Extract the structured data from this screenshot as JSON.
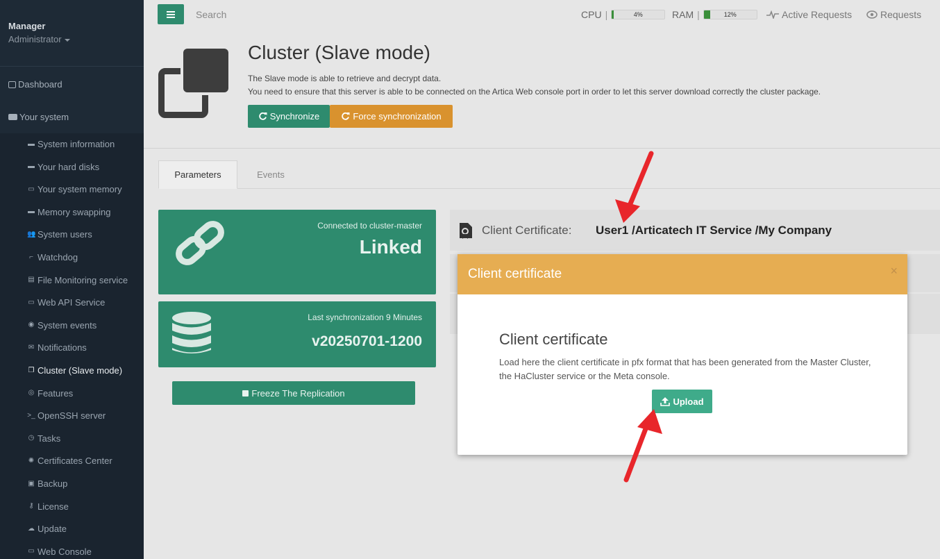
{
  "sidebar": {
    "profile_name": "Manager",
    "profile_role": "Administrator",
    "dashboard": "Dashboard",
    "your_system": "Your system",
    "items": [
      {
        "label": "System information",
        "icon": "server-icon"
      },
      {
        "label": "Your hard disks",
        "icon": "hdd-icon"
      },
      {
        "label": "Your system memory",
        "icon": "memory-icon"
      },
      {
        "label": "Memory swapping",
        "icon": "swap-icon"
      },
      {
        "label": "System users",
        "icon": "users-icon"
      },
      {
        "label": "Watchdog",
        "icon": "dog-icon"
      },
      {
        "label": "File Monitoring service",
        "icon": "file-icon"
      },
      {
        "label": "Web API Service",
        "icon": "api-icon"
      },
      {
        "label": "System events",
        "icon": "eye-icon"
      },
      {
        "label": "Notifications",
        "icon": "envelope-icon"
      },
      {
        "label": "Cluster (Slave mode)",
        "icon": "cluster-icon"
      },
      {
        "label": "Features",
        "icon": "features-icon"
      },
      {
        "label": "OpenSSH server",
        "icon": "terminal-icon"
      },
      {
        "label": "Tasks",
        "icon": "clock-icon"
      },
      {
        "label": "Certificates Center",
        "icon": "certificate-icon"
      },
      {
        "label": "Backup",
        "icon": "archive-icon"
      },
      {
        "label": "License",
        "icon": "key-icon"
      },
      {
        "label": "Update",
        "icon": "cloud-download-icon"
      },
      {
        "label": "Web Console",
        "icon": "window-icon"
      }
    ]
  },
  "topbar": {
    "search": "Search",
    "cpu_label": "CPU",
    "cpu_value": "4%",
    "cpu_fraction": 0.04,
    "ram_label": "RAM",
    "ram_value": "12%",
    "ram_fraction": 0.12,
    "sep": "|",
    "active_requests": "Active Requests",
    "requests": "Requests"
  },
  "header": {
    "title": "Cluster (Slave mode)",
    "desc_line1": "The Slave mode is able to retrieve and decrypt data.",
    "desc_line2": "You need to ensure that this server is able to be connected on the Artica Web console port in order to let this server download correctly the cluster package.",
    "sync_button": "Synchronize",
    "force_button": "Force synchronization"
  },
  "tabs": {
    "parameters": "Parameters",
    "events": "Events"
  },
  "panels": {
    "linked_caption": "Connected to cluster-master",
    "linked_value": "Linked",
    "sync_caption": "Last synchronization 9 Minutes",
    "sync_value": "v20250701-1200",
    "freeze_button": "Freeze The Replication"
  },
  "cert": {
    "label": "Client Certificate:",
    "value": "User1 /Articatech IT Service /My Company"
  },
  "modal": {
    "title": "Client certificate",
    "close": "×",
    "heading": "Client certificate",
    "text": "Load here the client certificate in pfx format that has been generated from the Master Cluster, the HaCluster service or the Meta console.",
    "upload_button": "Upload"
  },
  "colors": {
    "brand_green": "#2e8b6e",
    "warning_orange": "#d9922e",
    "modal_header": "#e6ad52",
    "sidebar_bg": "#1e2a36",
    "annotation_red": "#e8262b"
  }
}
